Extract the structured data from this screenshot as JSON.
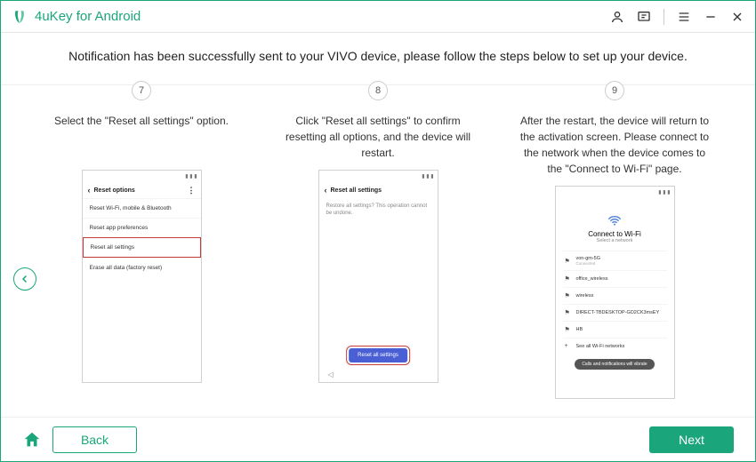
{
  "titlebar": {
    "app_name": "4uKey for Android"
  },
  "main": {
    "headline": "Notification has been successfully sent to your VIVO device, please follow the steps below to set up your device."
  },
  "steps": [
    {
      "num": "7",
      "desc": "Select the \"Reset all settings\" option.",
      "phone": {
        "appbar_title": "Reset options",
        "items": [
          "Reset Wi-Fi, mobile & Bluetooth",
          "Reset app preferences",
          "Reset all settings",
          "Erase all data (factory reset)"
        ]
      }
    },
    {
      "num": "8",
      "desc": "Click \"Reset all settings\" to confirm resetting all options, and the device will restart.",
      "phone": {
        "appbar_title": "Reset all settings",
        "dialog_text": "Restore all settings? This operation cannot be undone.",
        "button_label": "Reset all settings"
      }
    },
    {
      "num": "9",
      "desc": "After the restart, the device will return to the activation screen. Please connect to the network when the device comes to the \"Connect to Wi-Fi\" page.",
      "phone": {
        "wifi_title": "Connect to Wi-Fi",
        "wifi_sub": "Select a network",
        "networks": [
          {
            "name": "von-gm-5G",
            "sub": "Connected"
          },
          {
            "name": "office_wireless",
            "sub": ""
          },
          {
            "name": "wireless",
            "sub": ""
          },
          {
            "name": "DIRECT-TBDESKTOP-GD2CK3msEY",
            "sub": ""
          },
          {
            "name": "HB",
            "sub": ""
          },
          {
            "name": "See all Wi-Fi networks",
            "sub": ""
          }
        ],
        "pill": "Calls and notifications will vibrate"
      }
    }
  ],
  "footer": {
    "back_label": "Back",
    "next_label": "Next"
  }
}
